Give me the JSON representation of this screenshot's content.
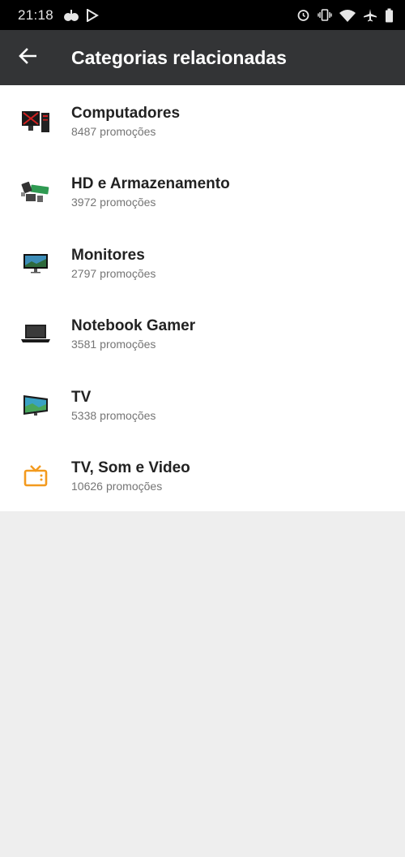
{
  "status": {
    "time": "21:18"
  },
  "header": {
    "title": "Categorias relacionadas"
  },
  "categories": [
    {
      "title": "Computadores",
      "count": "8487",
      "suffix": "promoções",
      "icon": "gaming-pc-icon"
    },
    {
      "title": "HD e Armazenamento",
      "count": "3972",
      "suffix": "promoções",
      "icon": "storage-icon"
    },
    {
      "title": "Monitores",
      "count": "2797",
      "suffix": "promoções",
      "icon": "monitor-icon"
    },
    {
      "title": "Notebook Gamer",
      "count": "3581",
      "suffix": "promoções",
      "icon": "laptop-icon"
    },
    {
      "title": "TV",
      "count": "5338",
      "suffix": "promoções",
      "icon": "tv-icon"
    },
    {
      "title": "TV, Som e Video",
      "count": "10626",
      "suffix": "promoções",
      "icon": "tv-outline-icon"
    }
  ],
  "colors": {
    "app_bar": "#333436",
    "status_bar": "#000000",
    "accent_orange": "#f39a1e",
    "background": "#eeeeee"
  }
}
